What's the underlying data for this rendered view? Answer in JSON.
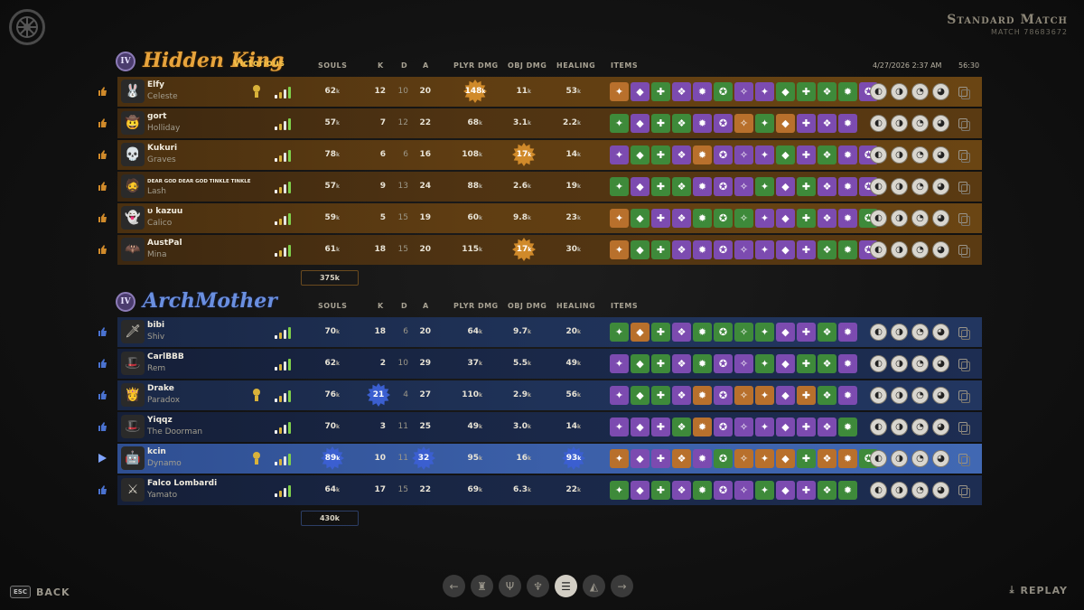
{
  "header": {
    "title": "Standard Match",
    "match_id": "MATCH 78683672"
  },
  "columns": {
    "souls": "SOULS",
    "k": "K",
    "d": "D",
    "a": "A",
    "plyr_dmg": "PLYR DMG",
    "obj_dmg": "OBJ DMG",
    "healing": "HEALING",
    "items": "ITEMS"
  },
  "date": "4/27/2026 2:37 AM",
  "duration": "56:30",
  "k_suffix": "k",
  "team1": {
    "rank": "IV",
    "name": "Hidden King",
    "result": "Victorious",
    "color": "#e8a43c",
    "souls_total": "375k",
    "players": [
      {
        "name": "Elfy",
        "hero": "Celeste",
        "souls": "62",
        "k": "12",
        "d": "10",
        "a": "20",
        "plyr": "148",
        "obj": "11",
        "heal": "53",
        "plyr_star": true,
        "rank_icon": true,
        "avatar": "🐰",
        "items": [
          "o",
          "p",
          "g",
          "p",
          "p",
          "g",
          "p",
          "p",
          "g",
          "g",
          "g",
          "g",
          "p"
        ],
        "abilities": [
          "◐",
          "◑",
          "◔",
          "◕"
        ]
      },
      {
        "name": "gort",
        "hero": "Holliday",
        "souls": "57",
        "k": "7",
        "d": "12",
        "a": "22",
        "plyr": "68",
        "obj": "3.1",
        "heal": "2.2",
        "avatar": "🤠",
        "items": [
          "g",
          "p",
          "g",
          "g",
          "p",
          "p",
          "o",
          "g",
          "o",
          "p",
          "p",
          "p"
        ],
        "abilities": [
          "◐",
          "◑",
          "◔",
          "◕"
        ]
      },
      {
        "name": "Kukuri",
        "hero": "Graves",
        "souls": "78",
        "k": "6",
        "d": "6",
        "a": "16",
        "plyr": "108",
        "obj": "17",
        "heal": "14",
        "obj_star": true,
        "avatar": "💀",
        "items": [
          "p",
          "g",
          "g",
          "p",
          "o",
          "p",
          "p",
          "p",
          "g",
          "p",
          "g",
          "p",
          "p"
        ],
        "abilities": [
          "◐",
          "◑",
          "◔",
          "◕"
        ]
      },
      {
        "name": "DEAR GOD DEAR GOD TINKLE TINKLE",
        "hero": "Lash",
        "souls": "57",
        "k": "9",
        "d": "13",
        "a": "24",
        "plyr": "88",
        "obj": "2.6",
        "heal": "19",
        "small_name": true,
        "avatar": "🧔",
        "items": [
          "g",
          "p",
          "g",
          "g",
          "p",
          "p",
          "p",
          "g",
          "p",
          "g",
          "p",
          "p",
          "p"
        ],
        "abilities": [
          "◐",
          "◑",
          "◔",
          "◕"
        ]
      },
      {
        "name": "υ kazuu",
        "hero": "Calico",
        "souls": "59",
        "k": "5",
        "d": "15",
        "a": "19",
        "plyr": "60",
        "obj": "9.8",
        "heal": "23",
        "avatar": "👻",
        "items": [
          "o",
          "g",
          "p",
          "p",
          "g",
          "g",
          "g",
          "p",
          "p",
          "g",
          "p",
          "p",
          "g"
        ],
        "abilities": [
          "◐",
          "◑",
          "◔",
          "◕"
        ]
      },
      {
        "name": "AustPal",
        "hero": "Mina",
        "souls": "61",
        "k": "18",
        "d": "15",
        "a": "20",
        "plyr": "115",
        "obj": "17",
        "heal": "30",
        "obj_star": true,
        "avatar": "🦇",
        "items": [
          "o",
          "g",
          "g",
          "p",
          "p",
          "p",
          "p",
          "p",
          "p",
          "p",
          "g",
          "g",
          "p"
        ],
        "abilities": [
          "◐",
          "◑",
          "◔",
          "◕"
        ]
      }
    ]
  },
  "team2": {
    "rank": "IV",
    "name": "ArchMother",
    "color": "#6a8fe0",
    "souls_total": "430k",
    "players": [
      {
        "name": "bibi",
        "hero": "Shiv",
        "souls": "70",
        "k": "18",
        "d": "6",
        "a": "20",
        "plyr": "64",
        "obj": "9.7",
        "heal": "20",
        "avatar": "🗡",
        "items": [
          "g",
          "o",
          "g",
          "p",
          "g",
          "g",
          "g",
          "g",
          "p",
          "p",
          "g",
          "p"
        ],
        "abilities": [
          "◐",
          "◑",
          "◔",
          "◕"
        ]
      },
      {
        "name": "CarlBBB",
        "hero": "Rem",
        "souls": "62",
        "k": "2",
        "d": "10",
        "a": "29",
        "plyr": "37",
        "obj": "5.5",
        "heal": "49",
        "avatar": "🎩",
        "items": [
          "p",
          "g",
          "g",
          "p",
          "g",
          "p",
          "p",
          "g",
          "p",
          "g",
          "g",
          "p"
        ],
        "abilities": [
          "◐",
          "◑",
          "◔",
          "◕"
        ]
      },
      {
        "name": "Drake",
        "hero": "Paradox",
        "souls": "76",
        "k": "21",
        "d": "4",
        "a": "27",
        "plyr": "110",
        "obj": "2.9",
        "heal": "56",
        "k_star": true,
        "rank_icon": true,
        "avatar": "👸",
        "items": [
          "p",
          "g",
          "g",
          "p",
          "o",
          "p",
          "o",
          "o",
          "p",
          "o",
          "g",
          "p"
        ],
        "abilities": [
          "◐",
          "◑",
          "◔",
          "◕"
        ]
      },
      {
        "name": "Yiqqz",
        "hero": "The Doorman",
        "souls": "70",
        "k": "3",
        "d": "11",
        "a": "25",
        "plyr": "49",
        "obj": "3.0",
        "heal": "14",
        "avatar": "🎩",
        "items": [
          "p",
          "p",
          "p",
          "g",
          "o",
          "p",
          "p",
          "p",
          "p",
          "p",
          "p",
          "g"
        ],
        "abilities": [
          "◐",
          "◑",
          "◔",
          "◕"
        ]
      },
      {
        "name": "kcin",
        "hero": "Dynamo",
        "souls": "89",
        "k": "10",
        "d": "11",
        "a": "32",
        "plyr": "95",
        "obj": "16",
        "heal": "93",
        "souls_star": true,
        "a_star": true,
        "heal_star": true,
        "rank_icon": true,
        "highlight": true,
        "avatar": "🤖",
        "items": [
          "o",
          "p",
          "p",
          "o",
          "p",
          "g",
          "o",
          "o",
          "o",
          "g",
          "o",
          "o",
          "g"
        ],
        "abilities": [
          "◐",
          "◑",
          "◔",
          "◕"
        ]
      },
      {
        "name": "Falco Lombardi",
        "hero": "Yamato",
        "souls": "64",
        "k": "17",
        "d": "15",
        "a": "22",
        "plyr": "69",
        "obj": "6.3",
        "heal": "22",
        "avatar": "⚔",
        "items": [
          "g",
          "p",
          "g",
          "p",
          "g",
          "p",
          "p",
          "g",
          "p",
          "p",
          "g",
          "g"
        ],
        "abilities": [
          "◐",
          "◑",
          "◔",
          "◕"
        ]
      }
    ]
  },
  "footer": {
    "esc": "ESC",
    "back": "BACK",
    "replay": "REPLAY"
  }
}
